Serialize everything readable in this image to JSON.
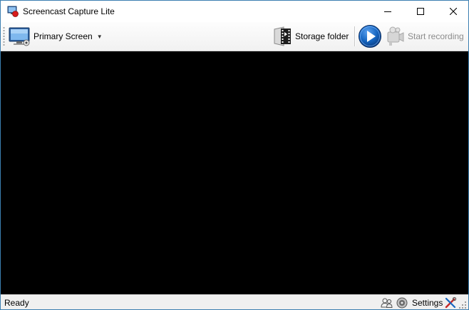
{
  "window": {
    "title": "Screencast Capture Lite",
    "icons": {
      "app": "app-icon",
      "minimize": "minimize-icon",
      "maximize": "maximize-icon",
      "close": "close-icon"
    }
  },
  "toolbar": {
    "screen_source": {
      "label": "Primary Screen",
      "icon": "monitor-icon",
      "dropdown_icon": "chevron-down-icon"
    },
    "storage_folder": {
      "label": "Storage folder",
      "icon": "film-folder-icon"
    },
    "play": {
      "icon": "play-icon"
    },
    "start_recording": {
      "label": "Start recording",
      "icon": "camcorder-icon",
      "enabled": false
    }
  },
  "statusbar": {
    "status": "Ready",
    "settings_label": "Settings",
    "icons": {
      "users": "users-icon",
      "disc": "disc-icon",
      "settings": "tools-icon",
      "grip": "resize-grip-icon"
    }
  },
  "colors": {
    "accent_blue": "#1565c0",
    "preview_background": "#000000",
    "disabled_text": "#8c8c8c",
    "window_border": "#3c7fb1"
  }
}
